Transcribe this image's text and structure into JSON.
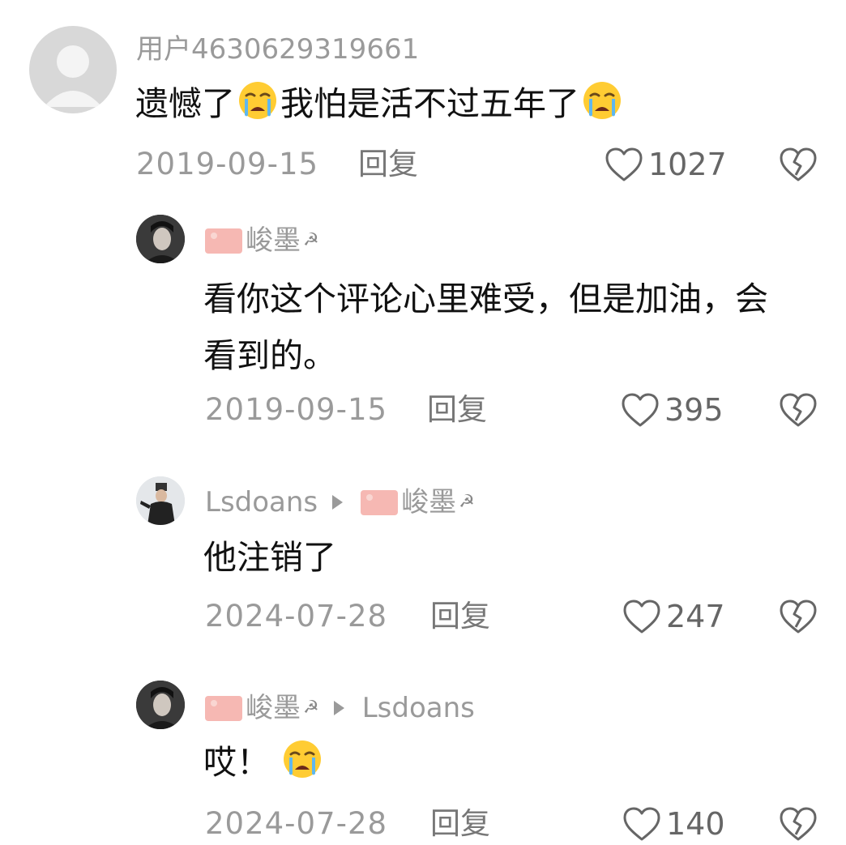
{
  "comments": [
    {
      "username": "用户4630629319661",
      "text_before": "遗憾了",
      "text_middle": "我怕是活不过五年了",
      "emoji": "crying-face",
      "date": "2019-09-15",
      "reply_label": "回复",
      "likes": "1027"
    },
    {
      "username": "峻墨",
      "text_line1": "看你这个评论心里难受，但是加油，会",
      "text_line2": "看到的。",
      "date": "2019-09-15",
      "reply_label": "回复",
      "likes": "395"
    },
    {
      "username": "Lsdoans",
      "reply_to": "峻墨",
      "text": "他注销了",
      "date": "2024-07-28",
      "reply_label": "回复",
      "likes": "247"
    },
    {
      "username": "峻墨",
      "reply_to": "Lsdoans",
      "text": "哎！",
      "emoji": "crying-face",
      "date": "2024-07-28",
      "reply_label": "回复",
      "likes": "140"
    }
  ],
  "colors": {
    "meta_text": "#9a9a9a",
    "body_text": "#111111",
    "background": "#ffffff"
  },
  "icons": [
    "heart-outline-icon",
    "broken-heart-icon",
    "reply-arrow-icon",
    "flag-icon",
    "sickle-icon",
    "crying-face-emoji"
  ]
}
